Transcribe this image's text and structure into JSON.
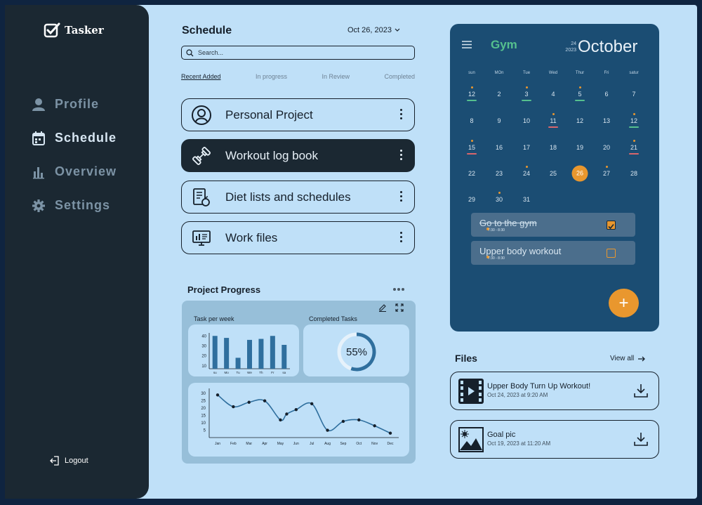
{
  "brand": {
    "name": "Tasker"
  },
  "sidebar": {
    "items": [
      {
        "label": "Profile",
        "icon": "user-icon"
      },
      {
        "label": "Schedule",
        "icon": "calendar-icon",
        "active": true
      },
      {
        "label": "Overview",
        "icon": "bar-chart-icon"
      },
      {
        "label": "Settings",
        "icon": "gear-icon"
      }
    ],
    "logout": "Logout"
  },
  "schedule": {
    "title": "Schedule",
    "date": "Oct 26, 2023",
    "search_placeholder": "Search...",
    "tabs": [
      "Recent Added",
      "In progress",
      "In Review",
      "Completed"
    ],
    "projects": [
      {
        "label": "Personal Project",
        "icon": "user-circle-icon"
      },
      {
        "label": "Workout log book",
        "icon": "dumbbell-icon",
        "active": true
      },
      {
        "label": "Diet lists and schedules",
        "icon": "diet-list-icon"
      },
      {
        "label": "Work files",
        "icon": "monitor-icon"
      }
    ]
  },
  "progress": {
    "title": "Project Progress",
    "task_per_week_label": "Task per week",
    "completed_label": "Completed Tasks",
    "completed_percent": "55%"
  },
  "chart_data": [
    {
      "type": "bar",
      "title": "Task per week",
      "categories": [
        "su",
        "Mo",
        "Tu",
        "We",
        "Th",
        "Fr",
        "sa"
      ],
      "values": [
        40,
        38,
        18,
        36,
        37,
        40,
        31
      ],
      "yticks": [
        40,
        30,
        20,
        10
      ],
      "ylim": [
        7,
        43
      ],
      "color": "#2f6f9e"
    },
    {
      "type": "pie",
      "title": "Completed Tasks",
      "values": [
        55,
        45
      ],
      "center_label": "55%",
      "color": "#2f6f9e"
    },
    {
      "type": "line",
      "categories": [
        "Jan",
        "Feb",
        "Mar",
        "Apr",
        "May",
        "Jun",
        "Jul",
        "Aug",
        "Sep",
        "Oct",
        "Nov",
        "Dec"
      ],
      "values": [
        29,
        21,
        24,
        25,
        12,
        19,
        23,
        5,
        11,
        12,
        8,
        3
      ],
      "extra_points": [
        {
          "x": 4.4,
          "y": 16
        }
      ],
      "yticks": [
        30,
        25,
        20,
        15,
        10,
        5
      ],
      "ylim": [
        0,
        32
      ],
      "color": "#16202b"
    }
  ],
  "calendar": {
    "title": "Gym",
    "day_small": "24",
    "year_small": "2023",
    "month": "October",
    "weekdays": [
      "sun",
      "MOn",
      "Tue",
      "Wed",
      "Thur",
      "Fri",
      "satur"
    ],
    "days": [
      {
        "d": "12",
        "dot": true,
        "bar": "#55c08e"
      },
      {
        "d": "2"
      },
      {
        "d": "3",
        "dot": true,
        "bar": "#55c08e"
      },
      {
        "d": "4"
      },
      {
        "d": "5",
        "dot": true,
        "bar": "#55c08e"
      },
      {
        "d": "6"
      },
      {
        "d": "7"
      },
      {
        "d": "8"
      },
      {
        "d": "9"
      },
      {
        "d": "10"
      },
      {
        "d": "11",
        "dot": true,
        "bar": "#d9666c"
      },
      {
        "d": "12"
      },
      {
        "d": "13"
      },
      {
        "d": "12",
        "dot": true,
        "bar": "#55c08e"
      },
      {
        "d": "15",
        "dot": true,
        "bar": "#d9666c"
      },
      {
        "d": "16"
      },
      {
        "d": "17"
      },
      {
        "d": "18"
      },
      {
        "d": "19"
      },
      {
        "d": "20"
      },
      {
        "d": "21",
        "dot": true,
        "bar": "#d9666c"
      },
      {
        "d": "22"
      },
      {
        "d": "23"
      },
      {
        "d": "24",
        "dot": true
      },
      {
        "d": "25"
      },
      {
        "d": "26",
        "today": true
      },
      {
        "d": "27",
        "dot": true
      },
      {
        "d": "28"
      },
      {
        "d": "29"
      },
      {
        "d": "30",
        "dot": true
      },
      {
        "d": "31"
      }
    ],
    "tasks": [
      {
        "name": "Go to the gym",
        "time": "7:30 - 8:30",
        "done": true
      },
      {
        "name": "Upper body workout",
        "time": "7:30 - 8:30",
        "done": false
      }
    ],
    "add_label": "+"
  },
  "files": {
    "title": "Files",
    "view_all": "View all",
    "items": [
      {
        "name": "Upper Body Turn Up Workout!",
        "date": "Oct 24, 2023 at 9:20 AM",
        "icon": "video-file-icon"
      },
      {
        "name": "Goal pic",
        "date": "Oct 19, 2023 at 11:20 AM",
        "icon": "image-file-icon"
      }
    ]
  },
  "colors": {
    "accent": "#e9972e",
    "dark": "#1b2832",
    "calendar": "#1b4d73",
    "background": "#bfe0f8",
    "green": "#55c08e"
  }
}
